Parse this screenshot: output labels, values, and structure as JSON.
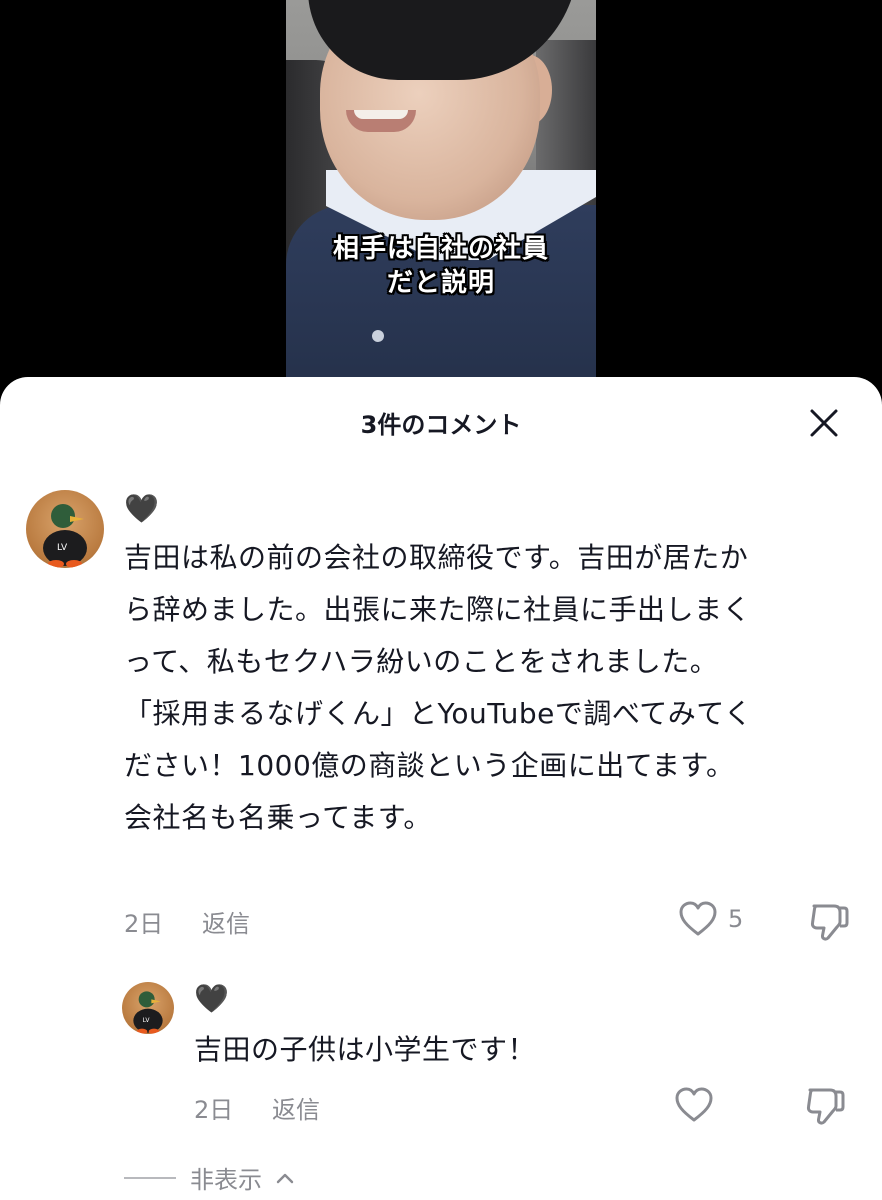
{
  "video": {
    "caption_lines": [
      "相手は自社の社員",
      "だと説明"
    ]
  },
  "comments_panel": {
    "title": "3件のコメント"
  },
  "comment": {
    "username": "🖤",
    "text_lines": [
      "吉田は私の前の会社の取締役です。吉田が居たか",
      "ら辞めました。出張に来た際に社員に手出しまく",
      "って、私もセクハラ紛いのことをされました。",
      "「採用まるなげくん」とYouTubeで調べてみてく",
      "ださい！1000億の商談という企画に出てます。",
      "会社名も名乗ってます。"
    ],
    "date": "2日",
    "reply_label": "返信",
    "like_count": "5"
  },
  "reply": {
    "username": "🖤",
    "text": "吉田の子供は小学生です！",
    "date": "2日",
    "reply_label": "返信"
  },
  "hide_replies_label": "非表示",
  "colors": {
    "sheet_background": "#ffffff",
    "primary_text": "#161823",
    "secondary_text": "#8a8b91"
  }
}
